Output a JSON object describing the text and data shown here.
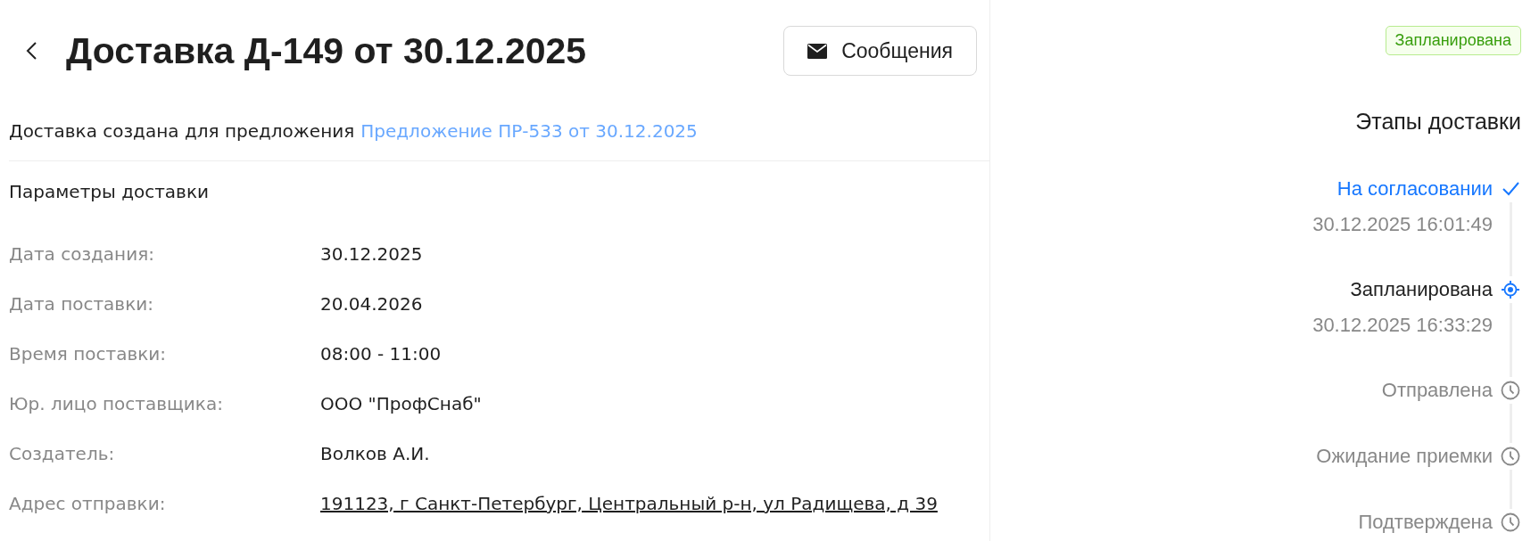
{
  "header": {
    "title": "Доставка Д-149 от 30.12.2025",
    "messages_button": "Сообщения"
  },
  "origin": {
    "text": "Доставка создана для предложения",
    "link": "Предложение ПР-533 от 30.12.2025"
  },
  "parameters": {
    "title": "Параметры доставки",
    "rows": [
      {
        "label": "Дата создания:",
        "value": "30.12.2025",
        "kind": "text"
      },
      {
        "label": "Дата поставки:",
        "value": "20.04.2026",
        "kind": "text"
      },
      {
        "label": "Время поставки:",
        "value": "08:00 - 11:00",
        "kind": "text"
      },
      {
        "label": "Юр. лицо поставщика:",
        "value": "ООО \"ПрофСнаб\"",
        "kind": "text"
      },
      {
        "label": "Создатель:",
        "value": "Волков А.И.",
        "kind": "text"
      },
      {
        "label": "Адрес отправки:",
        "value": "191123, г Санкт-Петербург, Центральный р-н, ул Радищева, д 39",
        "kind": "link"
      }
    ]
  },
  "status_badge": "Запланирована",
  "stages": {
    "title": "Этапы доставки",
    "items": [
      {
        "name": "На согласовании",
        "time": "30.12.2025 16:01:49",
        "kind": "done"
      },
      {
        "name": "Запланирована",
        "time": "30.12.2025 16:33:29",
        "kind": "current"
      },
      {
        "name": "Отправлена",
        "kind": "pending"
      },
      {
        "name": "Ожидание приемки",
        "kind": "pending"
      },
      {
        "name": "Подтверждена",
        "kind": "pending"
      }
    ]
  }
}
